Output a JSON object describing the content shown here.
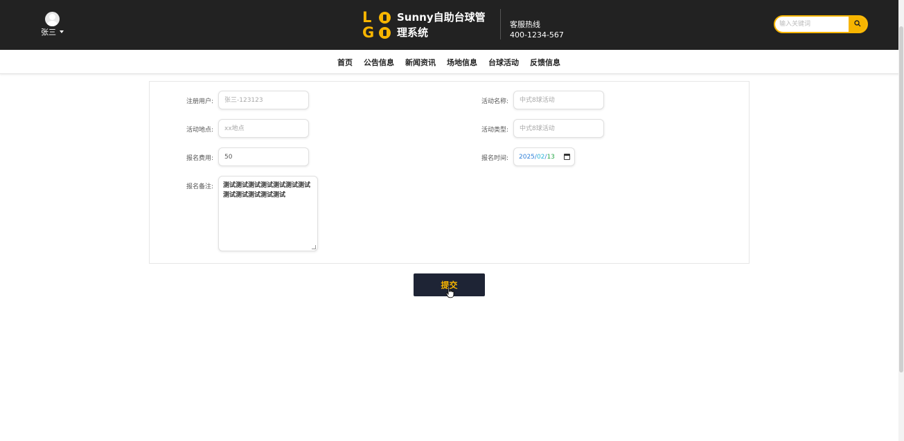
{
  "header": {
    "user_name": "张三",
    "logo_letters": [
      "L",
      "G"
    ],
    "site_title": "Sunny自助台球管理系统",
    "hotline_label": "客服热线",
    "hotline_number": "400-1234-567",
    "search_placeholder": "输入关键词",
    "accent_color": "#f7b500"
  },
  "nav": {
    "items": [
      "首页",
      "公告信息",
      "新闻资讯",
      "场地信息",
      "台球活动",
      "反馈信息"
    ]
  },
  "form": {
    "register_user": {
      "label": "注册用户:",
      "placeholder": "张三-123123"
    },
    "activity_name": {
      "label": "活动名称:",
      "placeholder": "中式8球活动"
    },
    "activity_place": {
      "label": "活动地点:",
      "placeholder": "xx地点"
    },
    "activity_type": {
      "label": "活动类型:",
      "placeholder": "中式8球活动"
    },
    "signup_fee": {
      "label": "报名费用:",
      "value": "50"
    },
    "signup_time": {
      "label": "报名时间:",
      "year": "2025",
      "month": "02",
      "day": "13",
      "separator": "/"
    },
    "signup_note": {
      "label": "报名备注:",
      "value": "测试测试测试测试测试测试测试测试测试测试测试测试"
    }
  },
  "submit_label": "提交"
}
